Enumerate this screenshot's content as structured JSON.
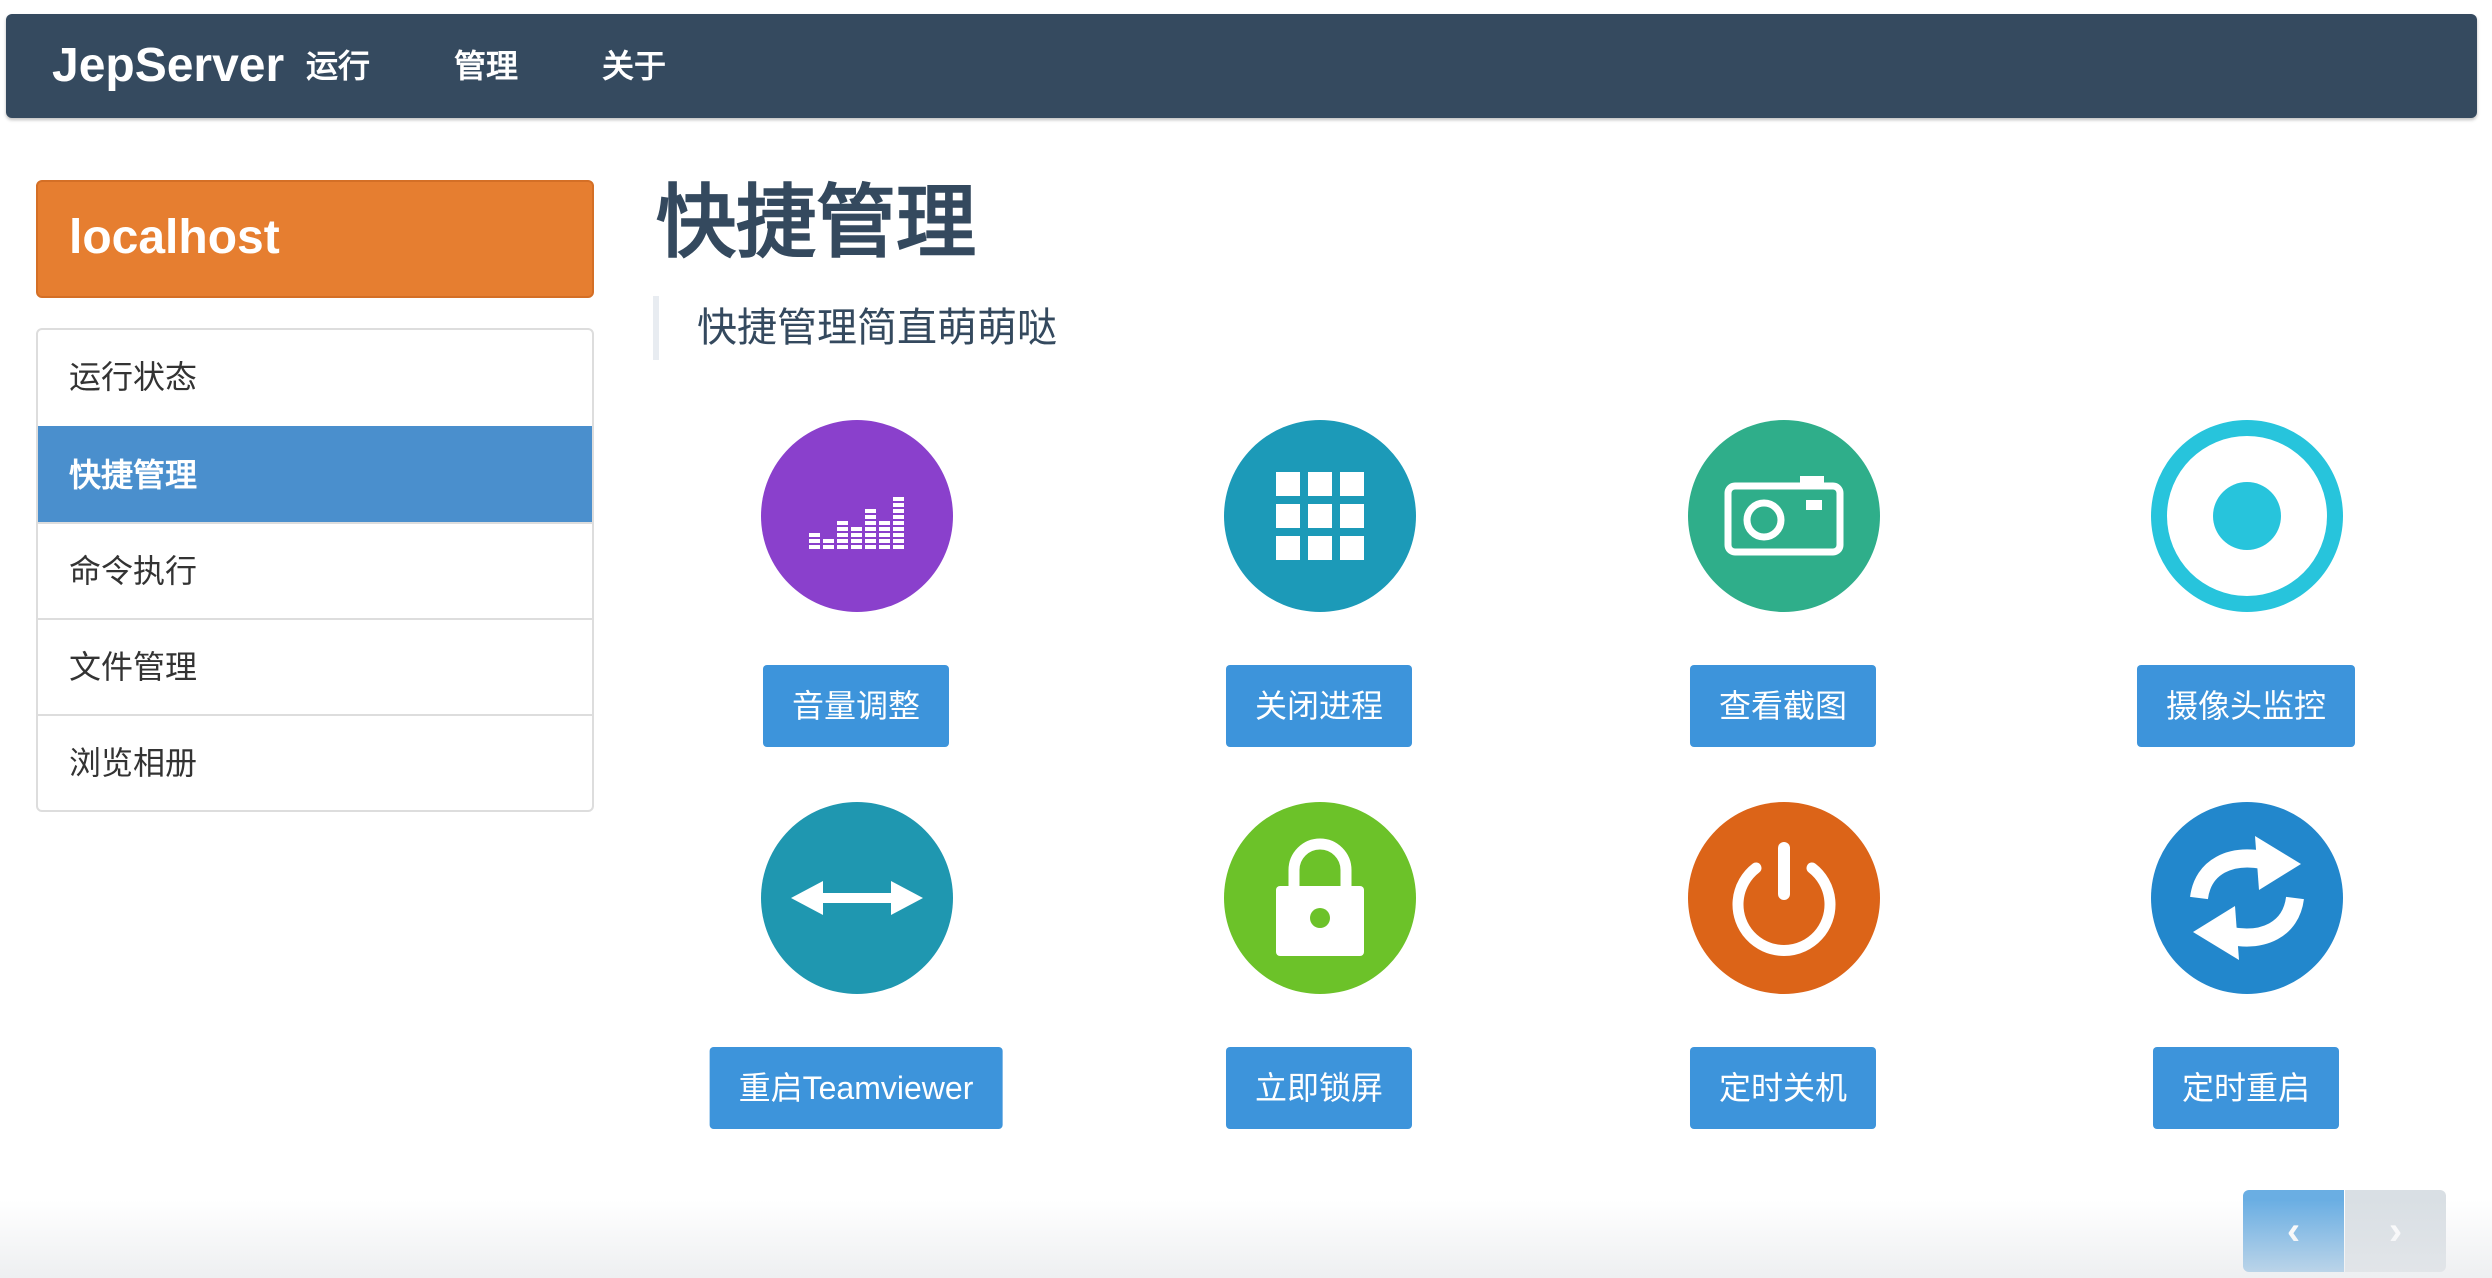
{
  "navbar": {
    "brand": "JepServer",
    "items": [
      {
        "label": "运行"
      },
      {
        "label": "管理"
      },
      {
        "label": "关于"
      }
    ]
  },
  "sidebar": {
    "host": "localhost",
    "items": [
      {
        "label": "运行状态",
        "active": false
      },
      {
        "label": "快捷管理",
        "active": true
      },
      {
        "label": "命令执行",
        "active": false
      },
      {
        "label": "文件管理",
        "active": false
      },
      {
        "label": "浏览相册",
        "active": false
      }
    ]
  },
  "main": {
    "title": "快捷管理",
    "subtitle": "快捷管理简直萌萌哒",
    "tiles": [
      {
        "label": "音量调整",
        "icon": "volume-equalizer-icon",
        "color": "#8a40cc"
      },
      {
        "label": "关闭进程",
        "icon": "grid-icon",
        "color": "#1c9ab8"
      },
      {
        "label": "查看截图",
        "icon": "camera-icon",
        "color": "#2fae8a"
      },
      {
        "label": "摄像头监控",
        "icon": "record-icon",
        "color": "#27c4dc"
      },
      {
        "label": "重启Teamviewer",
        "icon": "double-arrow-icon",
        "color": "#1f97b0"
      },
      {
        "label": "立即锁屏",
        "icon": "lock-icon",
        "color": "#6cc229"
      },
      {
        "label": "定时关机",
        "icon": "power-icon",
        "color": "#dc6418"
      },
      {
        "label": "定时重启",
        "icon": "refresh-icon",
        "color": "#2287cc"
      }
    ],
    "button_color": "#3d94db"
  },
  "pager": {
    "prev": "‹",
    "next": "›"
  }
}
